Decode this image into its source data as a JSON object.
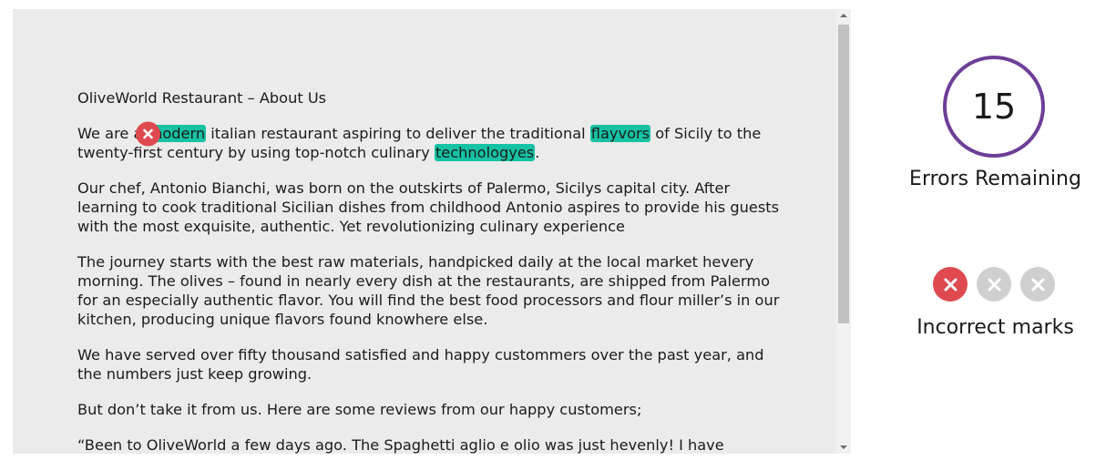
{
  "document": {
    "title": "OliveWorld Restaurant – About Us",
    "p1": {
      "t1": "We are a ",
      "h1": "modern",
      "t2": " italian restaurant aspiring to deliver the traditional ",
      "h2": "flayvors",
      "t3": " of Sicily to the twenty-first century by using top-notch culinary ",
      "h3": "technologyes",
      "t4": "."
    },
    "p2": "Our chef, Antonio Bianchi, was born on the outskirts of Palermo, Sicilys capital city. After learning to cook traditional Sicilian dishes from childhood Antonio aspires to provide his guests with the most exquisite, authentic. Yet revolutionizing culinary experience",
    "p3": "The journey starts with the best raw materials, handpicked daily at the local market hevery morning. The olives – found in nearly every dish at the restaurants, are shipped from Palermo for an especially authentic flavor. You will find the best food processors and flour miller’s in our kitchen, producing unique flavors found knowhere else.",
    "p4": "We have served over fifty thousand satisfied and happy custommers over the past year, and the numbers just keep growing.",
    "p5": "But don’t take it from us. Here are some reviews from our happy customers;",
    "p6": "“Been to OliveWorld a few days ago. The Spaghetti aglio e olio was just hevenly! I have"
  },
  "status": {
    "errors_remaining": "15",
    "errors_label": "Errors Remaining",
    "marks_label": "Incorrect marks",
    "incorrect_marks_used": 1,
    "incorrect_marks_total": 3
  },
  "icons": {
    "incorrect_mark": "close-icon",
    "scroll_up": "triangle-up-icon",
    "scroll_down": "triangle-down-icon"
  },
  "colors": {
    "highlight": "#16c2a3",
    "mark_active": "#de4a4f",
    "mark_inactive": "#cfcfcf",
    "ring": "#6e3f97",
    "panel_bg": "#ebebeb"
  }
}
